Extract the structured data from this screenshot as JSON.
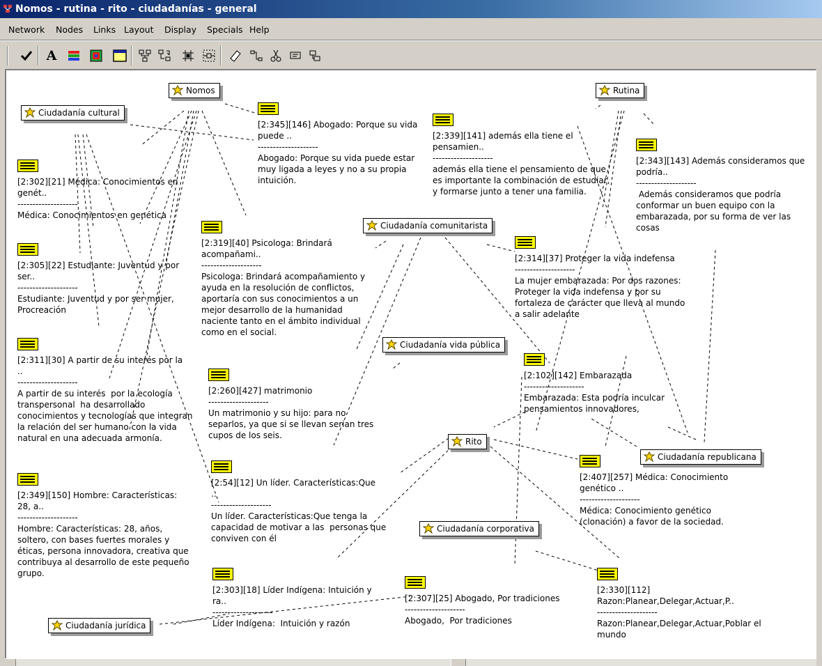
{
  "window": {
    "title": "Nomos - rutina - rito - ciudadanías - general"
  },
  "menu": [
    "Network",
    "Nodes",
    "Links",
    "Layout",
    "Display",
    "Specials",
    "Help"
  ],
  "toolbar": {
    "icons": [
      "checkmark-icon",
      "font-icon",
      "color-lines-icon",
      "node-color-icon",
      "window-icon",
      "layout-tree-icon",
      "layout-import-icon",
      "layout-grid-icon",
      "layout-fit-icon",
      "eraser-icon",
      "connector-icon",
      "cut-icon",
      "comment-icon",
      "copy-node-icon"
    ]
  },
  "colors": {
    "accent_titlebar": "#0a246a",
    "memo_yellow": "#ffff00",
    "code_icon": "#ffd700",
    "canvas": "#ffffff"
  },
  "codes": {
    "nomos": "Nomos",
    "rutina": "Rutina",
    "cult": "Ciudadanía cultural",
    "comun": "Ciudadanía comunitarista",
    "vidapub": "Ciudadanía vida pública",
    "rito": "Rito",
    "repub": "Ciudadanía republicana",
    "corp": "Ciudadanía corporativa",
    "jurid": "Ciudadanía jurídica"
  },
  "memos": {
    "m1": {
      "header": "[2:345][146] Abogado: Porque su vida\npuede ..",
      "sep": "--------------------",
      "body": "Abogado: Porque su vida puede estar\nmuy ligada a leyes y no a su propia\nintuición."
    },
    "m2": {
      "header": "[2:339][141] además ella tiene el\npensamien..",
      "sep": "--------------------",
      "body": "además ella tiene el pensamiento de que\nes importante la combinación de estudiar,\ny formarse junto a tener una familia."
    },
    "m3": {
      "header": "[2:343][143] Además consideramos que\npodría..",
      "sep": "--------------------",
      "body": " Además consideramos que podría\nconformar un buen equipo con la\nembarazada, por su forma de ver las\ncosas"
    },
    "m4": {
      "header": "[2:302][21] Médica: Conocimientos en\ngenét..",
      "sep": "--------------------",
      "body": "Médica: Conocimientos en genética"
    },
    "m5": {
      "header": "[2:305][22] Estudiante: Juventud y por\nser..",
      "sep": "--------------------",
      "body": "Estudiante: Juventud y por ser mujer,\nProcreación"
    },
    "m6": {
      "header": "[2:319][40] Psicologa: Brindará\nacompañami..",
      "sep": "--------------------",
      "body": "Psicologa: Brindará acompañamiento y\nayuda en la resolución de conflictos,\naportaría con sus conocimientos a un\nmejor desarrollo de la humanidad\nnaciente tanto en el ámbito individual\ncomo en el social."
    },
    "m7": {
      "header": "[2:314][37] Proteger la vida indefensa",
      "sep": "--------------------",
      "body": "La mujer embarazada: Por dos razones:\nProteger la vida indefensa y por su\nfortaleza de carácter que lleva al mundo\na salir adelante"
    },
    "m8": {
      "header": "[2:311][30] A partir de su interés por la\n..",
      "sep": "--------------------",
      "body": "A partir de su interés  por la ecología\ntranspersonal  ha desarrollado\nconocimientos y tecnologías que integran\nla relación del ser humano con la vida\nnatural en una adecuada armonía."
    },
    "m9": {
      "header": "[2:102][142] Embarazada",
      "sep": "--------------------",
      "body": "Embarazada: Esta podría inculcar\npensamientos innovadores,"
    },
    "m10": {
      "header": "[2:260][427] matrimonio",
      "sep": "--------------------",
      "body": "Un matrimonio y su hijo: para no\nseparlos, ya que si se llevan serian tres\ncupos de los seis."
    },
    "m11": {
      "header": "[2:407][257] Médica: Conocimiento\ngenético ..",
      "sep": "--------------------",
      "body": "Médica: Conocimiento genético\n(clonación) a favor de la sociedad."
    },
    "m12": {
      "header": "[2:349][150] Hombre: Características:\n28, a..",
      "sep": "--------------------",
      "body": "Hombre: Características: 28, años,\nsoltero, con bases fuertes morales y\néticas, persona innovadora, creativa que\ncontribuya al desarrollo de este pequeño\ngrupo."
    },
    "m13": {
      "header": "[2:54][12] Un líder. Características:Que\n..",
      "sep": "--------------------",
      "body": "Un líder. Características:Que tenga la\ncapacidad de motivar a las  personas que\nconviven con él"
    },
    "m14": {
      "header": "[2:303][18] Líder Indígena: Intuición y\nra..",
      "sep": "--------------------",
      "body": "Líder Indígena:  Intuición y razón"
    },
    "m15": {
      "header": "[2:307][25] Abogado, Por tradiciones",
      "sep": "--------------------",
      "body": "Abogado,  Por tradiciones"
    },
    "m16": {
      "header": "[2:330][112]\nRazon:Planear,Delegar,Actuar,P..",
      "sep": "--------------------",
      "body": "Razon:Planear,Delegar,Actuar,Poblar el\nmundo"
    }
  }
}
